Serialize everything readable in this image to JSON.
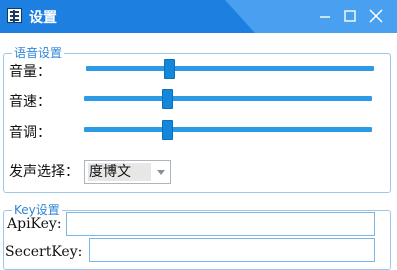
{
  "window": {
    "title": "设置",
    "icon": "settings-app-icon"
  },
  "titlebar_buttons": [
    "minimize-icon",
    "maximize-icon",
    "close-icon"
  ],
  "voice_group": {
    "legend": "语音设置",
    "sliders": [
      {
        "label": "音量：",
        "value_percent": 29
      },
      {
        "label": "音速：",
        "value_percent": 29
      },
      {
        "label": "音调：",
        "value_percent": 29
      }
    ],
    "voice_select": {
      "label": "发声选择：",
      "value": "度博文"
    }
  },
  "key_group": {
    "legend": "Key设置",
    "api_key": {
      "label": "ApiKey:",
      "value": ""
    },
    "secret_key": {
      "label": "SecertKey:",
      "value": ""
    }
  },
  "colors": {
    "titlebar": "#1d7fe0",
    "titlebar_accent": "#4aa0f0",
    "slider_track": "#2a9be4",
    "slider_thumb": "#1387d9",
    "legend_text": "#2f86d6",
    "group_border": "#9cc7ea"
  }
}
